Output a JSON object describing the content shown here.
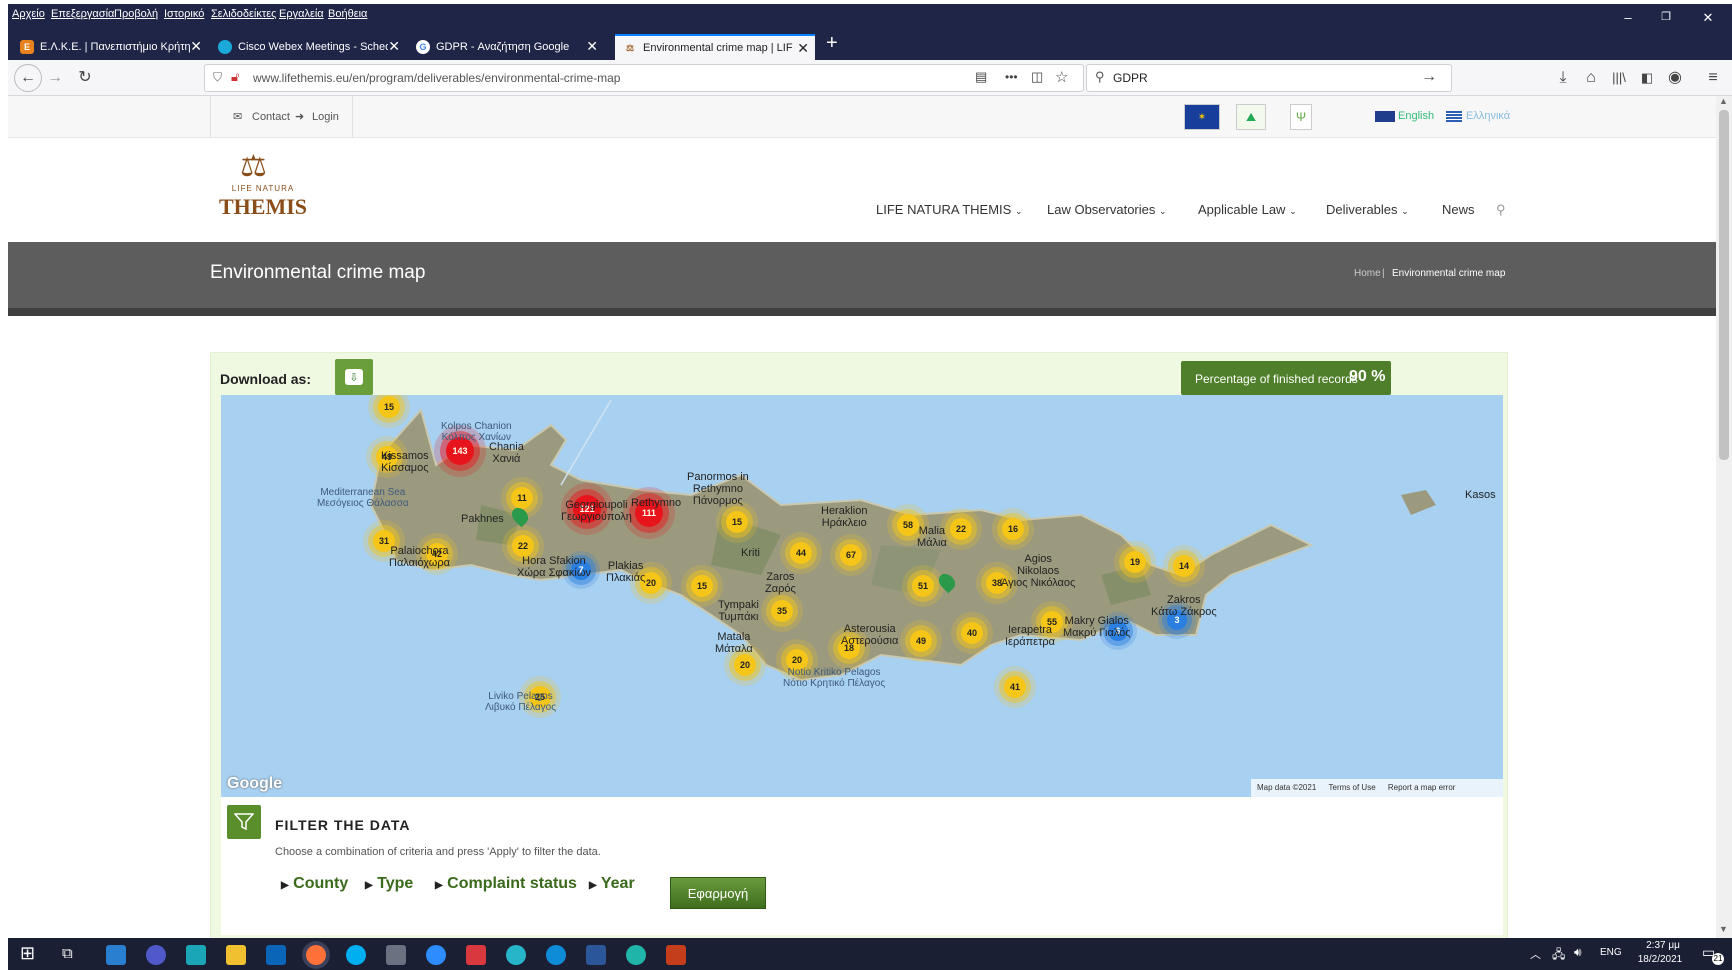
{
  "menubar": {
    "items": [
      "Αρχείο",
      "Επεξεργασία",
      "Προβολή",
      "Ιστορικό",
      "Σελιδοδείκτες",
      "Εργαλεία",
      "Βοήθεια"
    ]
  },
  "window_controls": {
    "minimize": "–",
    "restore": "❐",
    "close": "✕"
  },
  "tabs": [
    {
      "label": "Ε.Λ.Κ.Ε. | Πανεπιστήμιο Κρήτης",
      "favicon_text": "E",
      "favicon_color": "#e8821e"
    },
    {
      "label": "Cisco Webex Meetings - Sched",
      "favicon_text": "●",
      "favicon_color": "#1aa9d8"
    },
    {
      "label": "GDPR - Αναζήτηση Google",
      "favicon_text": "G",
      "favicon_color": "#ffffff"
    },
    {
      "label": "Environmental crime map | LIF",
      "favicon_text": "⚖",
      "favicon_color": "#f6f6f8",
      "active": true
    }
  ],
  "new_tab_label": "+",
  "toolbar": {
    "url": "www.lifethemis.eu/en/program/deliverables/environmental-crime-map",
    "search_value": "GDPR",
    "more_label": "•••"
  },
  "site": {
    "topbar": {
      "contact": "Contact",
      "login": "Login",
      "lang_en": "English",
      "lang_el": "Ελληνικά"
    },
    "logo": {
      "line1": "LIFE NATURA",
      "line2": "THEMIS"
    },
    "nav": [
      "LIFE NATURA THEMIS",
      "Law Observatories",
      "Applicable Law",
      "Deliverables",
      "News"
    ],
    "banner": {
      "title": "Environmental crime map",
      "breadcrumb_home": "Home",
      "breadcrumb_sep": "|",
      "breadcrumb_current": "Environmental crime map"
    },
    "download_label": "Download as:",
    "progress": {
      "label": "Percentage of finished records",
      "value": "90 %",
      "fraction": 0.9
    },
    "map": {
      "attribution": {
        "data": "Map data ©2021",
        "terms": "Terms of Use",
        "report": "Report a map error"
      },
      "google_label": "Google",
      "clusters": [
        {
          "n": "15",
          "c": "y"
        },
        {
          "n": "49",
          "c": "y"
        },
        {
          "n": "143",
          "c": "r"
        },
        {
          "n": "11",
          "c": "y"
        },
        {
          "n": "121",
          "c": "r"
        },
        {
          "n": "111",
          "c": "r"
        },
        {
          "n": "31",
          "c": "y"
        },
        {
          "n": "42",
          "c": "y"
        },
        {
          "n": "22",
          "c": "y"
        },
        {
          "n": "7",
          "c": "b"
        },
        {
          "n": "20",
          "c": "y"
        },
        {
          "n": "15",
          "c": "y"
        },
        {
          "n": "15",
          "c": "y"
        },
        {
          "n": "44",
          "c": "y"
        },
        {
          "n": "67",
          "c": "y"
        },
        {
          "n": "35",
          "c": "y"
        },
        {
          "n": "58",
          "c": "y"
        },
        {
          "n": "22",
          "c": "y"
        },
        {
          "n": "16",
          "c": "y"
        },
        {
          "n": "51",
          "c": "y"
        },
        {
          "n": "38",
          "c": "y"
        },
        {
          "n": "19",
          "c": "y"
        },
        {
          "n": "14",
          "c": "y"
        },
        {
          "n": "55",
          "c": "y"
        },
        {
          "n": "6",
          "c": "b"
        },
        {
          "n": "3",
          "c": "b"
        },
        {
          "n": "49",
          "c": "y"
        },
        {
          "n": "40",
          "c": "y"
        },
        {
          "n": "18",
          "c": "y"
        },
        {
          "n": "20",
          "c": "y"
        },
        {
          "n": "20",
          "c": "y"
        },
        {
          "n": "41",
          "c": "y"
        },
        {
          "n": "25",
          "c": "y"
        }
      ],
      "labels": {
        "kolpos": "Kolpos Chanion\nΚόλπος Χανίων",
        "chania": "Chania\nΧανιά",
        "kissamos": "Kissamos\nΚίσσαμος",
        "med": "Mediterranean Sea\nΜεσόγειος Θάλασσα",
        "pakhnes": "Pakhnes",
        "palaio": "Palaiochora\nΠαλαιόχωρα",
        "hora": "Hora Sfakion\nΧώρα Σφακίων",
        "plakias": "Plakias\nΠλακιάς",
        "panormos": "Panormos in\nRethymno\nΠάνορμος",
        "rethymno": "Rethymno",
        "gerani": "Georgioupoli\nΓεωργιούπολη",
        "heraklion": "Heraklion\nΗράκλειο",
        "malia": "Malia\nΜάλια",
        "kriti": "Kriti",
        "agios": "Agios\nNikolaos\nΆγιος Νικόλαος",
        "zaros": "Zaros\nΖαρός",
        "tympaki": "Tympaki\nΤυμπάκι",
        "matala": "Matala\nΜάταλα",
        "asterousia": "Asterousia\nΑστερούσια",
        "ierapetra": "Ierapetra\nΙεράπετρα",
        "makry": "Makry Gialos\nΜακρύ Γιαλός",
        "zakros": "Zakros\nΚάτω Ζάκρος",
        "notio": "Notio Kritiko Pelagos\nΝότιο Κρητικό Πέλαγος",
        "liviko": "Liviko Pelagos\nΛιβυκό Πέλαγος",
        "kasos": "Kasos"
      }
    },
    "filter": {
      "title": "FILTER THE DATA",
      "hint": "Choose a combination of criteria and press 'Apply' to filter the data.",
      "tabs": [
        "County",
        "Type",
        "Complaint status",
        "Year"
      ],
      "apply": "Εφαρμογή"
    }
  },
  "taskbar": {
    "lang": "ENG",
    "time": "2:37 μμ",
    "date": "18/2/2021",
    "notif": "21"
  },
  "colors": {
    "titlebar": "#1f2547",
    "accent_green": "#5a8e2a",
    "banner": "#5d5d5d",
    "progress_bg": "#4f7f2a"
  }
}
